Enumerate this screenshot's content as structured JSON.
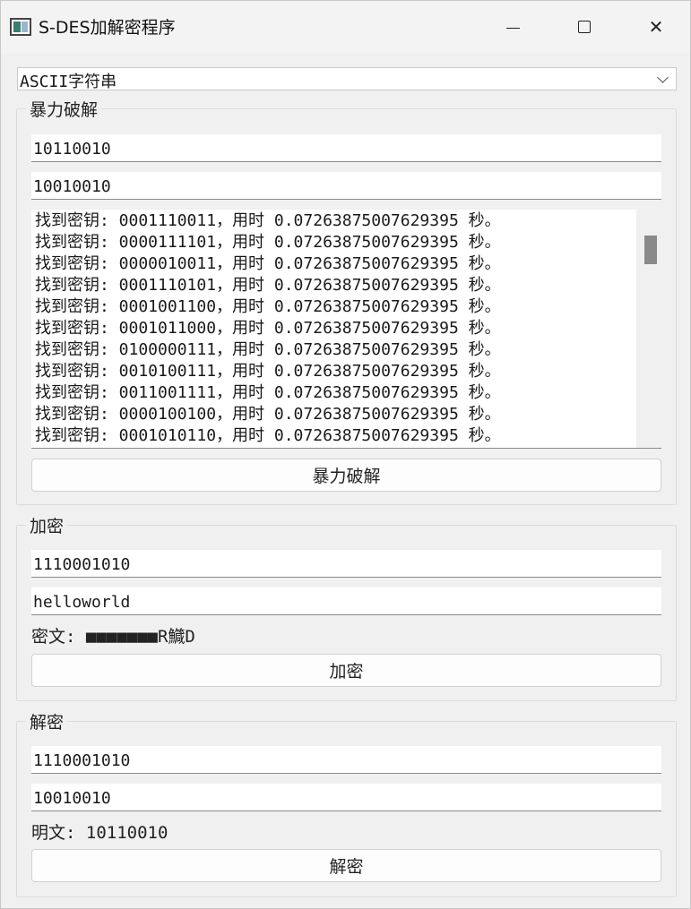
{
  "window": {
    "title": "S-DES加解密程序"
  },
  "mode_select": {
    "value": "ASCII字符串"
  },
  "brute_force": {
    "group_title": "暴力破解",
    "plaintext_value": "10110010",
    "ciphertext_value": "10010010",
    "log_lines": [
      "找到密钥: 0001110011，用时 0.07263875007629395 秒。",
      "找到密钥: 0000111101，用时 0.07263875007629395 秒。",
      "找到密钥: 0000010011，用时 0.07263875007629395 秒。",
      "找到密钥: 0001110101，用时 0.07263875007629395 秒。",
      "找到密钥: 0001001100，用时 0.07263875007629395 秒。",
      "找到密钥: 0001011000，用时 0.07263875007629395 秒。",
      "找到密钥: 0100000111，用时 0.07263875007629395 秒。",
      "找到密钥: 0010100111，用时 0.07263875007629395 秒。",
      "找到密钥: 0011001111，用时 0.07263875007629395 秒。",
      "找到密钥: 0000100100，用时 0.07263875007629395 秒。",
      "找到密钥: 0001010110，用时 0.07263875007629395 秒。"
    ],
    "button_label": "暴力破解"
  },
  "encrypt": {
    "group_title": "加密",
    "key_value": "1110001010",
    "plaintext_value": "helloworld",
    "result_text": "密文: ■■■■■■■R鱵D",
    "button_label": "加密"
  },
  "decrypt": {
    "group_title": "解密",
    "key_value": "1110001010",
    "ciphertext_value": "10010010",
    "result_text": "明文: 10110010",
    "button_label": "解密"
  }
}
